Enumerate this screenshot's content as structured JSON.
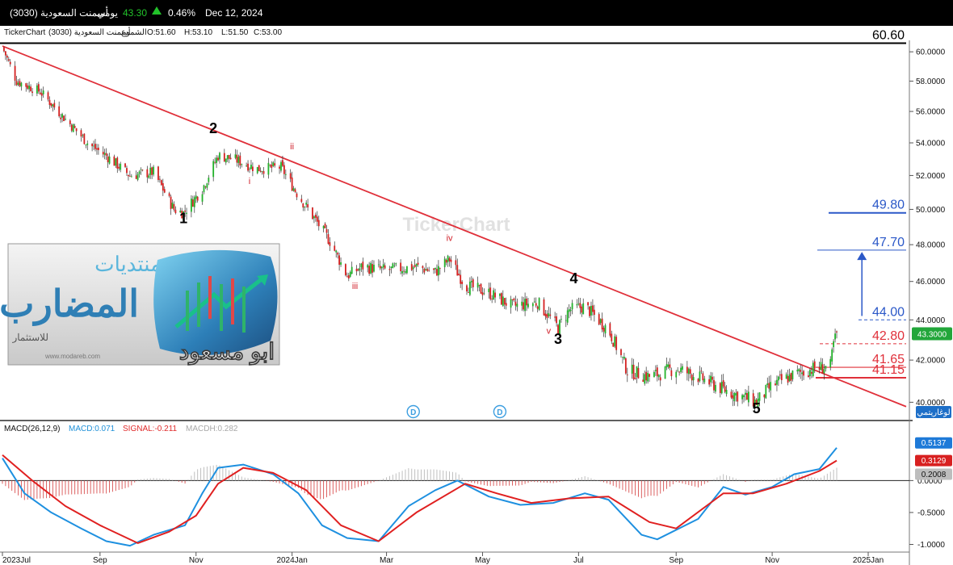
{
  "header": {
    "symbol_name": "(3030) أسمنت السعودية",
    "period": "يومي",
    "last_price": "43.30",
    "change_pct": "0.46%",
    "date": "Dec 12, 2024",
    "colors": {
      "up": "#22c22a",
      "background": "#000000"
    }
  },
  "ohlc_bar": {
    "app": "TickerChart",
    "symbol": "(3030) أسمنت السعودية",
    "chart_style": "الشموع",
    "open": "O:51.60",
    "high": "H:53.10",
    "low": "L:51.50",
    "close": "C:53.00"
  },
  "watermark": "TickerChart",
  "logo": {
    "line1": "منتديات",
    "line2": "المضارب",
    "line3": "للاستثمار",
    "url": "www.modareb.com",
    "signature": "ابو مسعود"
  },
  "log_button": "لوغاريتمي",
  "chart_data": [
    {
      "type": "candlestick",
      "ylim": [
        39.2,
        60.8
      ],
      "yscale": "log",
      "y_ticks": [
        "60.0000",
        "58.0000",
        "56.0000",
        "54.0000",
        "52.0000",
        "50.0000",
        "48.0000",
        "46.0000",
        "44.0000",
        "42.0000",
        "40.0000"
      ],
      "x_ticks": [
        "2023Jul",
        "Sep",
        "Nov",
        "2024Jan",
        "Mar",
        "May",
        "Jul",
        "Sep",
        "Nov",
        "2025Jan"
      ],
      "current_price_label": "43.3000",
      "price_path": [
        [
          "2023-07-01",
          60.3
        ],
        [
          "2023-07-10",
          58.0
        ],
        [
          "2023-07-25",
          57.3
        ],
        [
          "2023-08-10",
          55.5
        ],
        [
          "2023-08-25",
          53.9
        ],
        [
          "2023-09-05",
          53.2
        ],
        [
          "2023-09-20",
          52.0
        ],
        [
          "2023-10-05",
          52.2
        ],
        [
          "2023-10-18",
          50.0
        ],
        [
          "2023-10-24",
          49.8
        ],
        [
          "2023-11-05",
          51.2
        ],
        [
          "2023-11-15",
          53.2
        ],
        [
          "2023-11-25",
          53.0
        ],
        [
          "2023-12-10",
          52.4
        ],
        [
          "2023-12-25",
          52.5
        ],
        [
          "2024-01-05",
          50.8
        ],
        [
          "2024-01-15",
          49.5
        ],
        [
          "2024-01-25",
          48.2
        ],
        [
          "2024-02-05",
          46.3
        ],
        [
          "2024-02-15",
          46.8
        ],
        [
          "2024-03-01",
          46.6
        ],
        [
          "2024-03-20",
          46.8
        ],
        [
          "2024-04-01",
          46.5
        ],
        [
          "2024-04-10",
          47.2
        ],
        [
          "2024-04-20",
          45.8
        ],
        [
          "2024-05-05",
          45.4
        ],
        [
          "2024-05-20",
          44.7
        ],
        [
          "2024-06-05",
          44.9
        ],
        [
          "2024-06-18",
          43.6
        ],
        [
          "2024-06-25",
          44.5
        ],
        [
          "2024-07-05",
          44.7
        ],
        [
          "2024-07-20",
          43.5
        ],
        [
          "2024-08-01",
          41.5
        ],
        [
          "2024-08-15",
          41.2
        ],
        [
          "2024-09-01",
          41.6
        ],
        [
          "2024-09-15",
          41.2
        ],
        [
          "2024-10-01",
          40.6
        ],
        [
          "2024-10-15",
          40.2
        ],
        [
          "2024-10-22",
          40.0
        ],
        [
          "2024-11-01",
          40.8
        ],
        [
          "2024-11-15",
          41.3
        ],
        [
          "2024-11-28",
          41.6
        ],
        [
          "2024-12-08",
          41.7
        ],
        [
          "2024-12-10",
          42.8
        ],
        [
          "2024-12-12",
          43.3
        ]
      ],
      "annotations": {
        "wave_labels": [
          {
            "text": "1",
            "date": "2023-10-24",
            "price": 49.2,
            "color": "#000000"
          },
          {
            "text": "2",
            "date": "2023-11-12",
            "price": 54.6,
            "color": "#000000"
          },
          {
            "text": "3",
            "date": "2024-06-18",
            "price": 42.8,
            "color": "#000000"
          },
          {
            "text": "4",
            "date": "2024-06-28",
            "price": 45.9,
            "color": "#000000"
          },
          {
            "text": "5",
            "date": "2024-10-22",
            "price": 39.5,
            "color": "#000000"
          },
          {
            "text": "i",
            "date": "2023-12-05",
            "price": 51.5,
            "color": "#d0202a"
          },
          {
            "text": "ii",
            "date": "2024-01-01",
            "price": 53.6,
            "color": "#d0202a"
          },
          {
            "text": "iii",
            "date": "2024-02-10",
            "price": 45.6,
            "color": "#d0202a"
          },
          {
            "text": "iv",
            "date": "2024-04-10",
            "price": 48.2,
            "color": "#d0202a"
          },
          {
            "text": "v",
            "date": "2024-06-12",
            "price": 43.3,
            "color": "#d0202a"
          }
        ],
        "levels": [
          {
            "label": "60.60",
            "price": 60.6,
            "color": "#000000",
            "style": "solid"
          },
          {
            "label": "49.80",
            "price": 49.8,
            "color": "#2b58c8",
            "style": "solid"
          },
          {
            "label": "47.70",
            "price": 47.7,
            "color": "#2b58c8",
            "style": "solid"
          },
          {
            "label": "44.00",
            "price": 44.0,
            "color": "#2b58c8",
            "style": "dashed"
          },
          {
            "label": "42.80",
            "price": 42.8,
            "color": "#e0303a",
            "style": "dashed"
          },
          {
            "label": "41.65",
            "price": 41.65,
            "color": "#e0303a",
            "style": "solid"
          },
          {
            "label": "41.15",
            "price": 41.15,
            "color": "#e0303a",
            "style": "solid"
          }
        ],
        "trendline": {
          "from": [
            "2023-07-01",
            60.4
          ],
          "to": [
            "2025-01-15",
            39.8
          ],
          "color": "#e0303a"
        },
        "target_arrow": {
          "date": "2024-12-28",
          "from": 44.2,
          "to": 47.6,
          "color": "#2b58c8"
        },
        "dividend_markers": [
          {
            "text": "D",
            "date": "2024-03-18"
          },
          {
            "text": "D",
            "date": "2024-05-12"
          }
        ]
      }
    },
    {
      "type": "line",
      "title": "MACD(26,12,9)",
      "legend": [
        "MACD:0.071",
        "SIGNAL:-0.211",
        "MACDH:0.282"
      ],
      "ylim": [
        -1.12,
        0.7
      ],
      "y_ticks": [
        "-1.0000",
        "-0.5000",
        "0.0000"
      ],
      "last_values": {
        "macd": "0.5137",
        "signal": "0.3129",
        "hist": "0.2008"
      },
      "macd": [
        [
          "2023-07-01",
          0.35
        ],
        [
          "2023-07-15",
          -0.2
        ],
        [
          "2023-08-01",
          -0.5
        ],
        [
          "2023-08-20",
          -0.75
        ],
        [
          "2023-09-05",
          -0.95
        ],
        [
          "2023-09-20",
          -1.02
        ],
        [
          "2023-10-05",
          -0.85
        ],
        [
          "2023-10-25",
          -0.7
        ],
        [
          "2023-11-05",
          -0.2
        ],
        [
          "2023-11-15",
          0.2
        ],
        [
          "2023-12-01",
          0.25
        ],
        [
          "2023-12-20",
          0.1
        ],
        [
          "2024-01-05",
          -0.2
        ],
        [
          "2024-01-20",
          -0.7
        ],
        [
          "2024-02-05",
          -0.9
        ],
        [
          "2024-02-25",
          -0.95
        ],
        [
          "2024-03-15",
          -0.4
        ],
        [
          "2024-04-01",
          -0.15
        ],
        [
          "2024-04-15",
          0.0
        ],
        [
          "2024-05-05",
          -0.25
        ],
        [
          "2024-05-25",
          -0.38
        ],
        [
          "2024-06-15",
          -0.35
        ],
        [
          "2024-07-05",
          -0.2
        ],
        [
          "2024-07-20",
          -0.3
        ],
        [
          "2024-08-10",
          -0.85
        ],
        [
          "2024-08-20",
          -0.92
        ],
        [
          "2024-09-15",
          -0.6
        ],
        [
          "2024-10-01",
          -0.1
        ],
        [
          "2024-10-15",
          -0.22
        ],
        [
          "2024-11-01",
          -0.1
        ],
        [
          "2024-11-15",
          0.1
        ],
        [
          "2024-12-01",
          0.18
        ],
        [
          "2024-12-12",
          0.5137
        ]
      ],
      "signal": [
        [
          "2023-07-01",
          0.4
        ],
        [
          "2023-07-20",
          0.0
        ],
        [
          "2023-08-10",
          -0.4
        ],
        [
          "2023-09-01",
          -0.7
        ],
        [
          "2023-09-25",
          -0.98
        ],
        [
          "2023-10-15",
          -0.8
        ],
        [
          "2023-11-01",
          -0.55
        ],
        [
          "2023-11-15",
          -0.05
        ],
        [
          "2023-12-01",
          0.2
        ],
        [
          "2023-12-20",
          0.12
        ],
        [
          "2024-01-10",
          -0.15
        ],
        [
          "2024-02-01",
          -0.7
        ],
        [
          "2024-02-25",
          -0.95
        ],
        [
          "2024-03-20",
          -0.5
        ],
        [
          "2024-04-20",
          -0.05
        ],
        [
          "2024-05-10",
          -0.2
        ],
        [
          "2024-06-01",
          -0.35
        ],
        [
          "2024-06-25",
          -0.28
        ],
        [
          "2024-07-20",
          -0.25
        ],
        [
          "2024-08-15",
          -0.65
        ],
        [
          "2024-09-01",
          -0.75
        ],
        [
          "2024-10-01",
          -0.2
        ],
        [
          "2024-10-20",
          -0.2
        ],
        [
          "2024-11-10",
          -0.05
        ],
        [
          "2024-12-01",
          0.15
        ],
        [
          "2024-12-12",
          0.3129
        ]
      ]
    }
  ]
}
